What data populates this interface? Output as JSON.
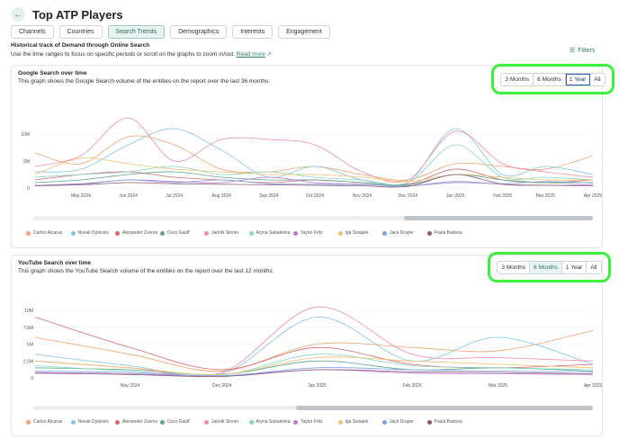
{
  "header": {
    "back_icon": "arrow-left-icon",
    "title": "Top ATP Players"
  },
  "tabs": [
    {
      "label": "Channels",
      "active": false
    },
    {
      "label": "Countries",
      "active": false
    },
    {
      "label": "Search Trends",
      "active": true
    },
    {
      "label": "Demographics",
      "active": false
    },
    {
      "label": "Interests",
      "active": false
    },
    {
      "label": "Engagement",
      "active": false
    }
  ],
  "intro": {
    "title": "Historical track of Demand through Online Search",
    "desc": "Use the time ranges to focus on specific periods or scroll on the graphs to zoom in/out.",
    "read_more": "Read more"
  },
  "filters_label": "Filters",
  "accent": "#3cf03c",
  "players": [
    {
      "name": "Carlos Alcaraz",
      "color": "#f4a26b"
    },
    {
      "name": "Novak Djokovic",
      "color": "#7fc6e4"
    },
    {
      "name": "Alexander Zverev",
      "color": "#d9676b"
    },
    {
      "name": "Coco Gauff",
      "color": "#5aa58c"
    },
    {
      "name": "Jannik Sinner",
      "color": "#f08aa8"
    },
    {
      "name": "Aryna Sabalenka",
      "color": "#86d6c2"
    },
    {
      "name": "Taylor Fritz",
      "color": "#b57ad6"
    },
    {
      "name": "Iga Świątek",
      "color": "#f0c070"
    },
    {
      "name": "Jack Draper",
      "color": "#7fa3e0"
    },
    {
      "name": "Paula Badosa",
      "color": "#8f5a7a"
    }
  ],
  "google": {
    "title": "Google Search over time",
    "subtitle": "This graph shows the Google Search volume of the entities on the report over the last 36 months.",
    "ranges": [
      "3 Months",
      "6 Months",
      "1 Year",
      "All"
    ],
    "selected_range": "1 Year"
  },
  "youtube": {
    "title": "YouTube Search over time",
    "subtitle": "This graph shows the YouTube Search volume of the entities on the report over the last 12 months.",
    "ranges": [
      "3 Months",
      "6 Months",
      "1 Year",
      "All"
    ],
    "selected_range": "6 Months"
  },
  "chart_data": [
    {
      "type": "line",
      "title": "Google Search over time",
      "categories": [
        "May 2024",
        "Jun 2024",
        "Jul 2024",
        "Aug 2024",
        "Sep 2024",
        "Oct 2024",
        "Nov 2024",
        "Dec 2024",
        "Jan 2025",
        "Feb 2025",
        "Mar 2025",
        "Apr 2025"
      ],
      "y_ticks": [
        "0",
        "5M",
        "10M"
      ],
      "ylim": [
        0,
        15000000
      ],
      "x": [
        "2024-04-01",
        "2024-05-01",
        "2024-06-01",
        "2024-07-01",
        "2024-08-01",
        "2024-09-01",
        "2024-10-01",
        "2024-11-01",
        "2024-12-01",
        "2025-01-01",
        "2025-02-01",
        "2025-03-01",
        "2025-04-01"
      ],
      "series": [
        {
          "name": "Carlos Alcaraz",
          "values": [
            6500000,
            4500000,
            9500000,
            8000000,
            3500000,
            3000000,
            4000000,
            2500000,
            1500000,
            4500000,
            4000000,
            3500000,
            6000000
          ]
        },
        {
          "name": "Novak Djokovic",
          "values": [
            3000000,
            3500000,
            8000000,
            11000000,
            7000000,
            2000000,
            4000000,
            1500000,
            1000000,
            11000000,
            2500000,
            4000000,
            2500000
          ]
        },
        {
          "name": "Alexander Zverev",
          "values": [
            1500000,
            2500000,
            3000000,
            2000000,
            1500000,
            1000000,
            1500000,
            1000000,
            700000,
            3500000,
            1500000,
            1000000,
            1500000
          ]
        },
        {
          "name": "Coco Gauff",
          "values": [
            1000000,
            1500000,
            2500000,
            3000000,
            2000000,
            1500000,
            1500000,
            1000000,
            600000,
            2500000,
            1500000,
            1000000,
            1000000
          ]
        },
        {
          "name": "Jannik Sinner",
          "values": [
            4000000,
            6000000,
            13000000,
            5000000,
            9000000,
            9000000,
            8000000,
            3000000,
            1500000,
            10500000,
            4500000,
            3000000,
            2000000
          ]
        },
        {
          "name": "Aryna Sabalenka",
          "values": [
            2000000,
            2500000,
            3000000,
            4000000,
            2500000,
            3000000,
            2000000,
            1500000,
            1000000,
            8000000,
            2000000,
            2000000,
            1500000
          ]
        },
        {
          "name": "Taylor Fritz",
          "values": [
            500000,
            800000,
            1500000,
            1200000,
            1000000,
            2000000,
            1000000,
            700000,
            400000,
            1200000,
            700000,
            500000,
            600000
          ]
        },
        {
          "name": "Iga Świątek",
          "values": [
            2500000,
            5500000,
            4500000,
            3500000,
            3000000,
            2500000,
            2500000,
            2000000,
            1200000,
            2500000,
            2000000,
            1500000,
            1500000
          ]
        },
        {
          "name": "Jack Draper",
          "values": [
            500000,
            700000,
            1500000,
            1000000,
            1500000,
            800000,
            700000,
            600000,
            400000,
            1000000,
            800000,
            1200000,
            900000
          ]
        },
        {
          "name": "Paula Badosa",
          "values": [
            400000,
            600000,
            1000000,
            800000,
            700000,
            600000,
            500000,
            400000,
            300000,
            2500000,
            700000,
            500000,
            400000
          ]
        }
      ]
    },
    {
      "type": "line",
      "title": "YouTube Search over time",
      "categories": [
        "Nov 2024",
        "Dec 2024",
        "Jan 2025",
        "Feb 2025",
        "Mar 2025",
        "Apr 2025"
      ],
      "y_ticks": [
        "0",
        "2.5M",
        "5M",
        "7.5M",
        "10M"
      ],
      "ylim": [
        0,
        12000000
      ],
      "x": [
        "2024-10-01",
        "2024-11-01",
        "2024-12-01",
        "2025-01-01",
        "2025-02-01",
        "2025-03-01",
        "2025-04-01"
      ],
      "series": [
        {
          "name": "Carlos Alcaraz",
          "values": [
            6000000,
            3500000,
            1000000,
            5000000,
            4500000,
            4000000,
            7000000
          ]
        },
        {
          "name": "Novak Djokovic",
          "values": [
            3500000,
            1800000,
            600000,
            9000000,
            2500000,
            6000000,
            2000000
          ]
        },
        {
          "name": "Alexander Zverev",
          "values": [
            9000000,
            4500000,
            1200000,
            4500000,
            2000000,
            1500000,
            2000000
          ]
        },
        {
          "name": "Coco Gauff",
          "values": [
            1500000,
            1200000,
            500000,
            2500000,
            1200000,
            1500000,
            1000000
          ]
        },
        {
          "name": "Jannik Sinner",
          "values": [
            2500000,
            1500000,
            800000,
            10500000,
            3500000,
            3000000,
            2500000
          ]
        },
        {
          "name": "Aryna Sabalenka",
          "values": [
            1800000,
            1000000,
            400000,
            3500000,
            1800000,
            1500000,
            1200000
          ]
        },
        {
          "name": "Taylor Fritz",
          "values": [
            800000,
            600000,
            300000,
            1200000,
            700000,
            600000,
            500000
          ]
        },
        {
          "name": "Iga Świątek",
          "values": [
            2500000,
            1500000,
            500000,
            3000000,
            2500000,
            2000000,
            1500000
          ]
        },
        {
          "name": "Jack Draper",
          "values": [
            1000000,
            800000,
            300000,
            1500000,
            1200000,
            1000000,
            900000
          ]
        },
        {
          "name": "Paula Badosa",
          "values": [
            700000,
            500000,
            200000,
            1200000,
            900000,
            800000,
            600000
          ]
        }
      ]
    }
  ]
}
